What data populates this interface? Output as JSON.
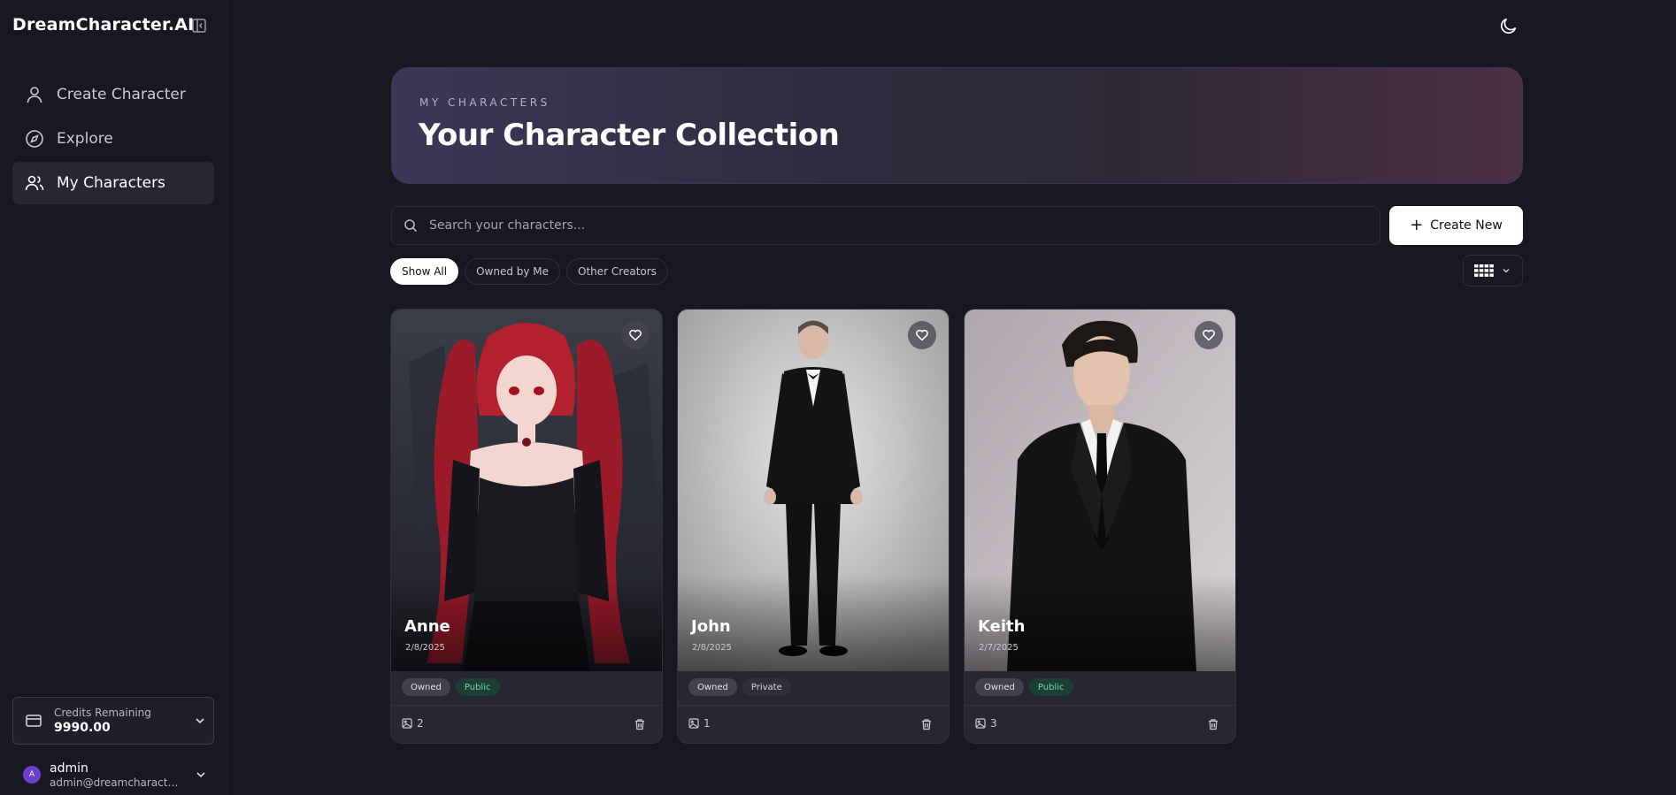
{
  "app": {
    "brand": "DreamCharacter.AI"
  },
  "sidebar": {
    "items": [
      {
        "label": "Create Character",
        "icon": "user-icon"
      },
      {
        "label": "Explore",
        "icon": "compass-icon"
      },
      {
        "label": "My Characters",
        "icon": "users-icon",
        "active": true
      }
    ],
    "credits": {
      "label": "Credits Remaining",
      "value": "9990.00"
    },
    "user": {
      "initial": "A",
      "name": "admin",
      "email": "admin@dreamcharacte..."
    }
  },
  "hero": {
    "eyebrow": "MY CHARACTERS",
    "title": "Your Character Collection"
  },
  "search": {
    "placeholder": "Search your characters..."
  },
  "toolbar": {
    "create_label": "Create New"
  },
  "filters": [
    {
      "label": "Show All",
      "active": true
    },
    {
      "label": "Owned by Me"
    },
    {
      "label": "Other Creators"
    }
  ],
  "cards": [
    {
      "name": "Anne",
      "date": "2/8/2025",
      "badges": [
        "Owned",
        "Public"
      ],
      "count": "2"
    },
    {
      "name": "John",
      "date": "2/8/2025",
      "badges": [
        "Owned",
        "Private"
      ],
      "count": "1"
    },
    {
      "name": "Keith",
      "date": "2/7/2025",
      "badges": [
        "Owned",
        "Public"
      ],
      "count": "3"
    }
  ],
  "colors": {
    "accent": "#ffffff",
    "background": "#171821",
    "public_badge": "#6fd6a6",
    "avatar": "#6b3fc9"
  }
}
